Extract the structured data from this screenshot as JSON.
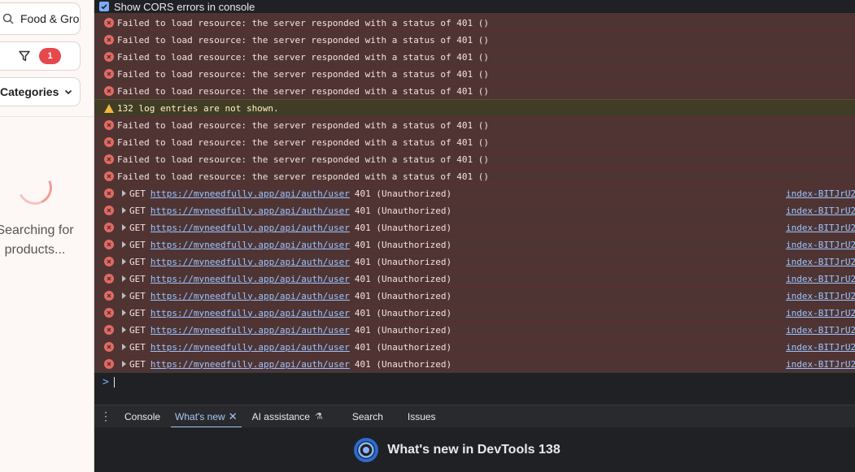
{
  "app": {
    "search_text": "Food & Groceries",
    "filter_count": "1",
    "categories_label": "Categories",
    "loading_line1": "Searching for",
    "loading_line2": "products..."
  },
  "devtools": {
    "cors_label": "Show CORS errors in console",
    "rows": [
      {
        "type": "error",
        "text": "Failed to load resource: the server responded with a status of 401 ()"
      },
      {
        "type": "error",
        "text": "Failed to load resource: the server responded with a status of 401 ()"
      },
      {
        "type": "error",
        "text": "Failed to load resource: the server responded with a status of 401 ()"
      },
      {
        "type": "error",
        "text": "Failed to load resource: the server responded with a status of 401 ()"
      },
      {
        "type": "error",
        "text": "Failed to load resource: the server responded with a status of 401 ()"
      },
      {
        "type": "warn",
        "text": "132 log entries are not shown."
      },
      {
        "type": "error",
        "text": "Failed to load resource: the server responded with a status of 401 ()"
      },
      {
        "type": "error",
        "text": "Failed to load resource: the server responded with a status of 401 ()"
      },
      {
        "type": "error",
        "text": "Failed to load resource: the server responded with a status of 401 ()"
      },
      {
        "type": "error",
        "text": "Failed to load resource: the server responded with a status of 401 ()"
      },
      {
        "type": "get",
        "method": "GET",
        "url": "https://myneedfully.app/api/auth/user",
        "status": "401 (Unauthorized)",
        "source": "index-BITJrU2"
      },
      {
        "type": "get",
        "method": "GET",
        "url": "https://myneedfully.app/api/auth/user",
        "status": "401 (Unauthorized)",
        "source": "index-BITJrU2"
      },
      {
        "type": "get",
        "method": "GET",
        "url": "https://myneedfully.app/api/auth/user",
        "status": "401 (Unauthorized)",
        "source": "index-BITJrU2"
      },
      {
        "type": "get",
        "method": "GET",
        "url": "https://myneedfully.app/api/auth/user",
        "status": "401 (Unauthorized)",
        "source": "index-BITJrU2"
      },
      {
        "type": "get",
        "method": "GET",
        "url": "https://myneedfully.app/api/auth/user",
        "status": "401 (Unauthorized)",
        "source": "index-BITJrU2"
      },
      {
        "type": "get",
        "method": "GET",
        "url": "https://myneedfully.app/api/auth/user",
        "status": "401 (Unauthorized)",
        "source": "index-BITJrU2"
      },
      {
        "type": "get",
        "method": "GET",
        "url": "https://myneedfully.app/api/auth/user",
        "status": "401 (Unauthorized)",
        "source": "index-BITJrU2"
      },
      {
        "type": "get",
        "method": "GET",
        "url": "https://myneedfully.app/api/auth/user",
        "status": "401 (Unauthorized)",
        "source": "index-BITJrU2"
      },
      {
        "type": "get",
        "method": "GET",
        "url": "https://myneedfully.app/api/auth/user",
        "status": "401 (Unauthorized)",
        "source": "index-BITJrU2"
      },
      {
        "type": "get",
        "method": "GET",
        "url": "https://myneedfully.app/api/auth/user",
        "status": "401 (Unauthorized)",
        "source": "index-BITJrU2"
      },
      {
        "type": "get",
        "method": "GET",
        "url": "https://myneedfully.app/api/auth/user",
        "status": "401 (Unauthorized)",
        "source": "index-BITJrU2"
      }
    ],
    "prompt_symbol": ">",
    "drawer_tabs": [
      "Console",
      "What's new",
      "AI assistance",
      "Search",
      "Issues"
    ],
    "active_tab": "What's new",
    "whats_new_title": "What's new in DevTools 138"
  },
  "colors": {
    "error_bg": "#4e3534",
    "warn_bg": "#413c26",
    "link": "#9ec3ff",
    "active_tab": "#a8c7fa",
    "badge": "#e5484d"
  }
}
